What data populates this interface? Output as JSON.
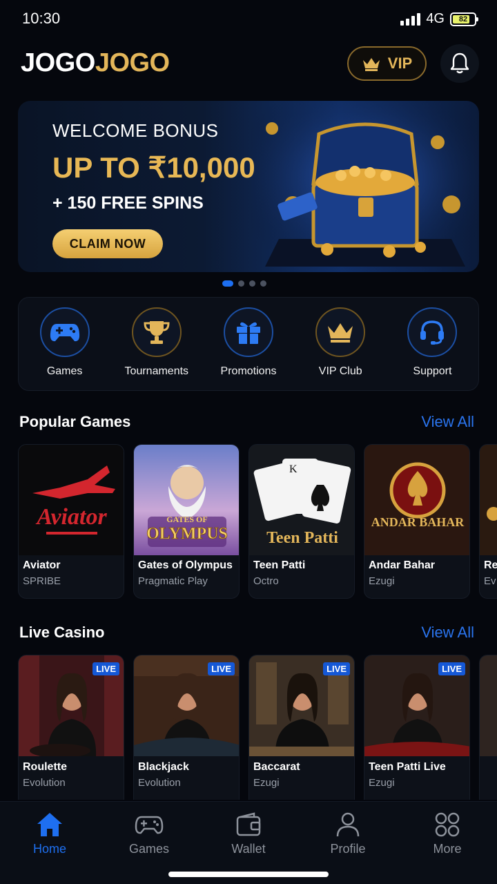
{
  "status_bar": {
    "time": "10:30",
    "network": "4G",
    "battery": "82"
  },
  "header": {
    "logo_part1": "JOGO",
    "logo_part2": "JOGO",
    "vip_label": "VIP"
  },
  "banner": {
    "line1": "WELCOME BONUS",
    "line2": "UP TO ₹10,000",
    "line3": "+ 150 FREE SPINS",
    "cta": "CLAIM NOW",
    "slides_total": 4,
    "active_slide": 1
  },
  "quick_menu": [
    {
      "label": "Games",
      "icon": "gamepad-icon"
    },
    {
      "label": "Tournaments",
      "icon": "trophy-icon"
    },
    {
      "label": "Promotions",
      "icon": "gift-icon"
    },
    {
      "label": "VIP Club",
      "icon": "crown-icon"
    },
    {
      "label": "Support",
      "icon": "headset-icon"
    }
  ],
  "popular": {
    "title": "Popular Games",
    "view_all": "View All",
    "games": [
      {
        "name": "Aviator",
        "provider": "SPRIBE",
        "art_text": "Aviator"
      },
      {
        "name": "Gates of Olympus",
        "provider": "Pragmatic Play",
        "art_text1": "GATES OF",
        "art_text2": "OLYMPUS"
      },
      {
        "name": "Teen Patti",
        "provider": "Octro",
        "art_text": "Teen Patti"
      },
      {
        "name": "Andar Bahar",
        "provider": "Ezugi",
        "art_text": "ANDAR BAHAR"
      },
      {
        "name": "Re",
        "provider": "Ev"
      }
    ]
  },
  "live": {
    "title": "Live Casino",
    "view_all": "View All",
    "badge": "LIVE",
    "games": [
      {
        "name": "Roulette",
        "provider": "Evolution"
      },
      {
        "name": "Blackjack",
        "provider": "Evolution"
      },
      {
        "name": "Baccarat",
        "provider": "Ezugi"
      },
      {
        "name": "Teen Patti Live",
        "provider": "Ezugi"
      }
    ]
  },
  "bottom_nav": [
    {
      "label": "Home",
      "icon": "home-icon",
      "active": true
    },
    {
      "label": "Games",
      "icon": "gamepad-icon",
      "active": false
    },
    {
      "label": "Wallet",
      "icon": "wallet-icon",
      "active": false
    },
    {
      "label": "Profile",
      "icon": "person-icon",
      "active": false
    },
    {
      "label": "More",
      "icon": "grid-icon",
      "active": false
    }
  ],
  "colors": {
    "accent_blue": "#1e6ff0",
    "gold": "#e3b65a",
    "background": "#05070d"
  }
}
